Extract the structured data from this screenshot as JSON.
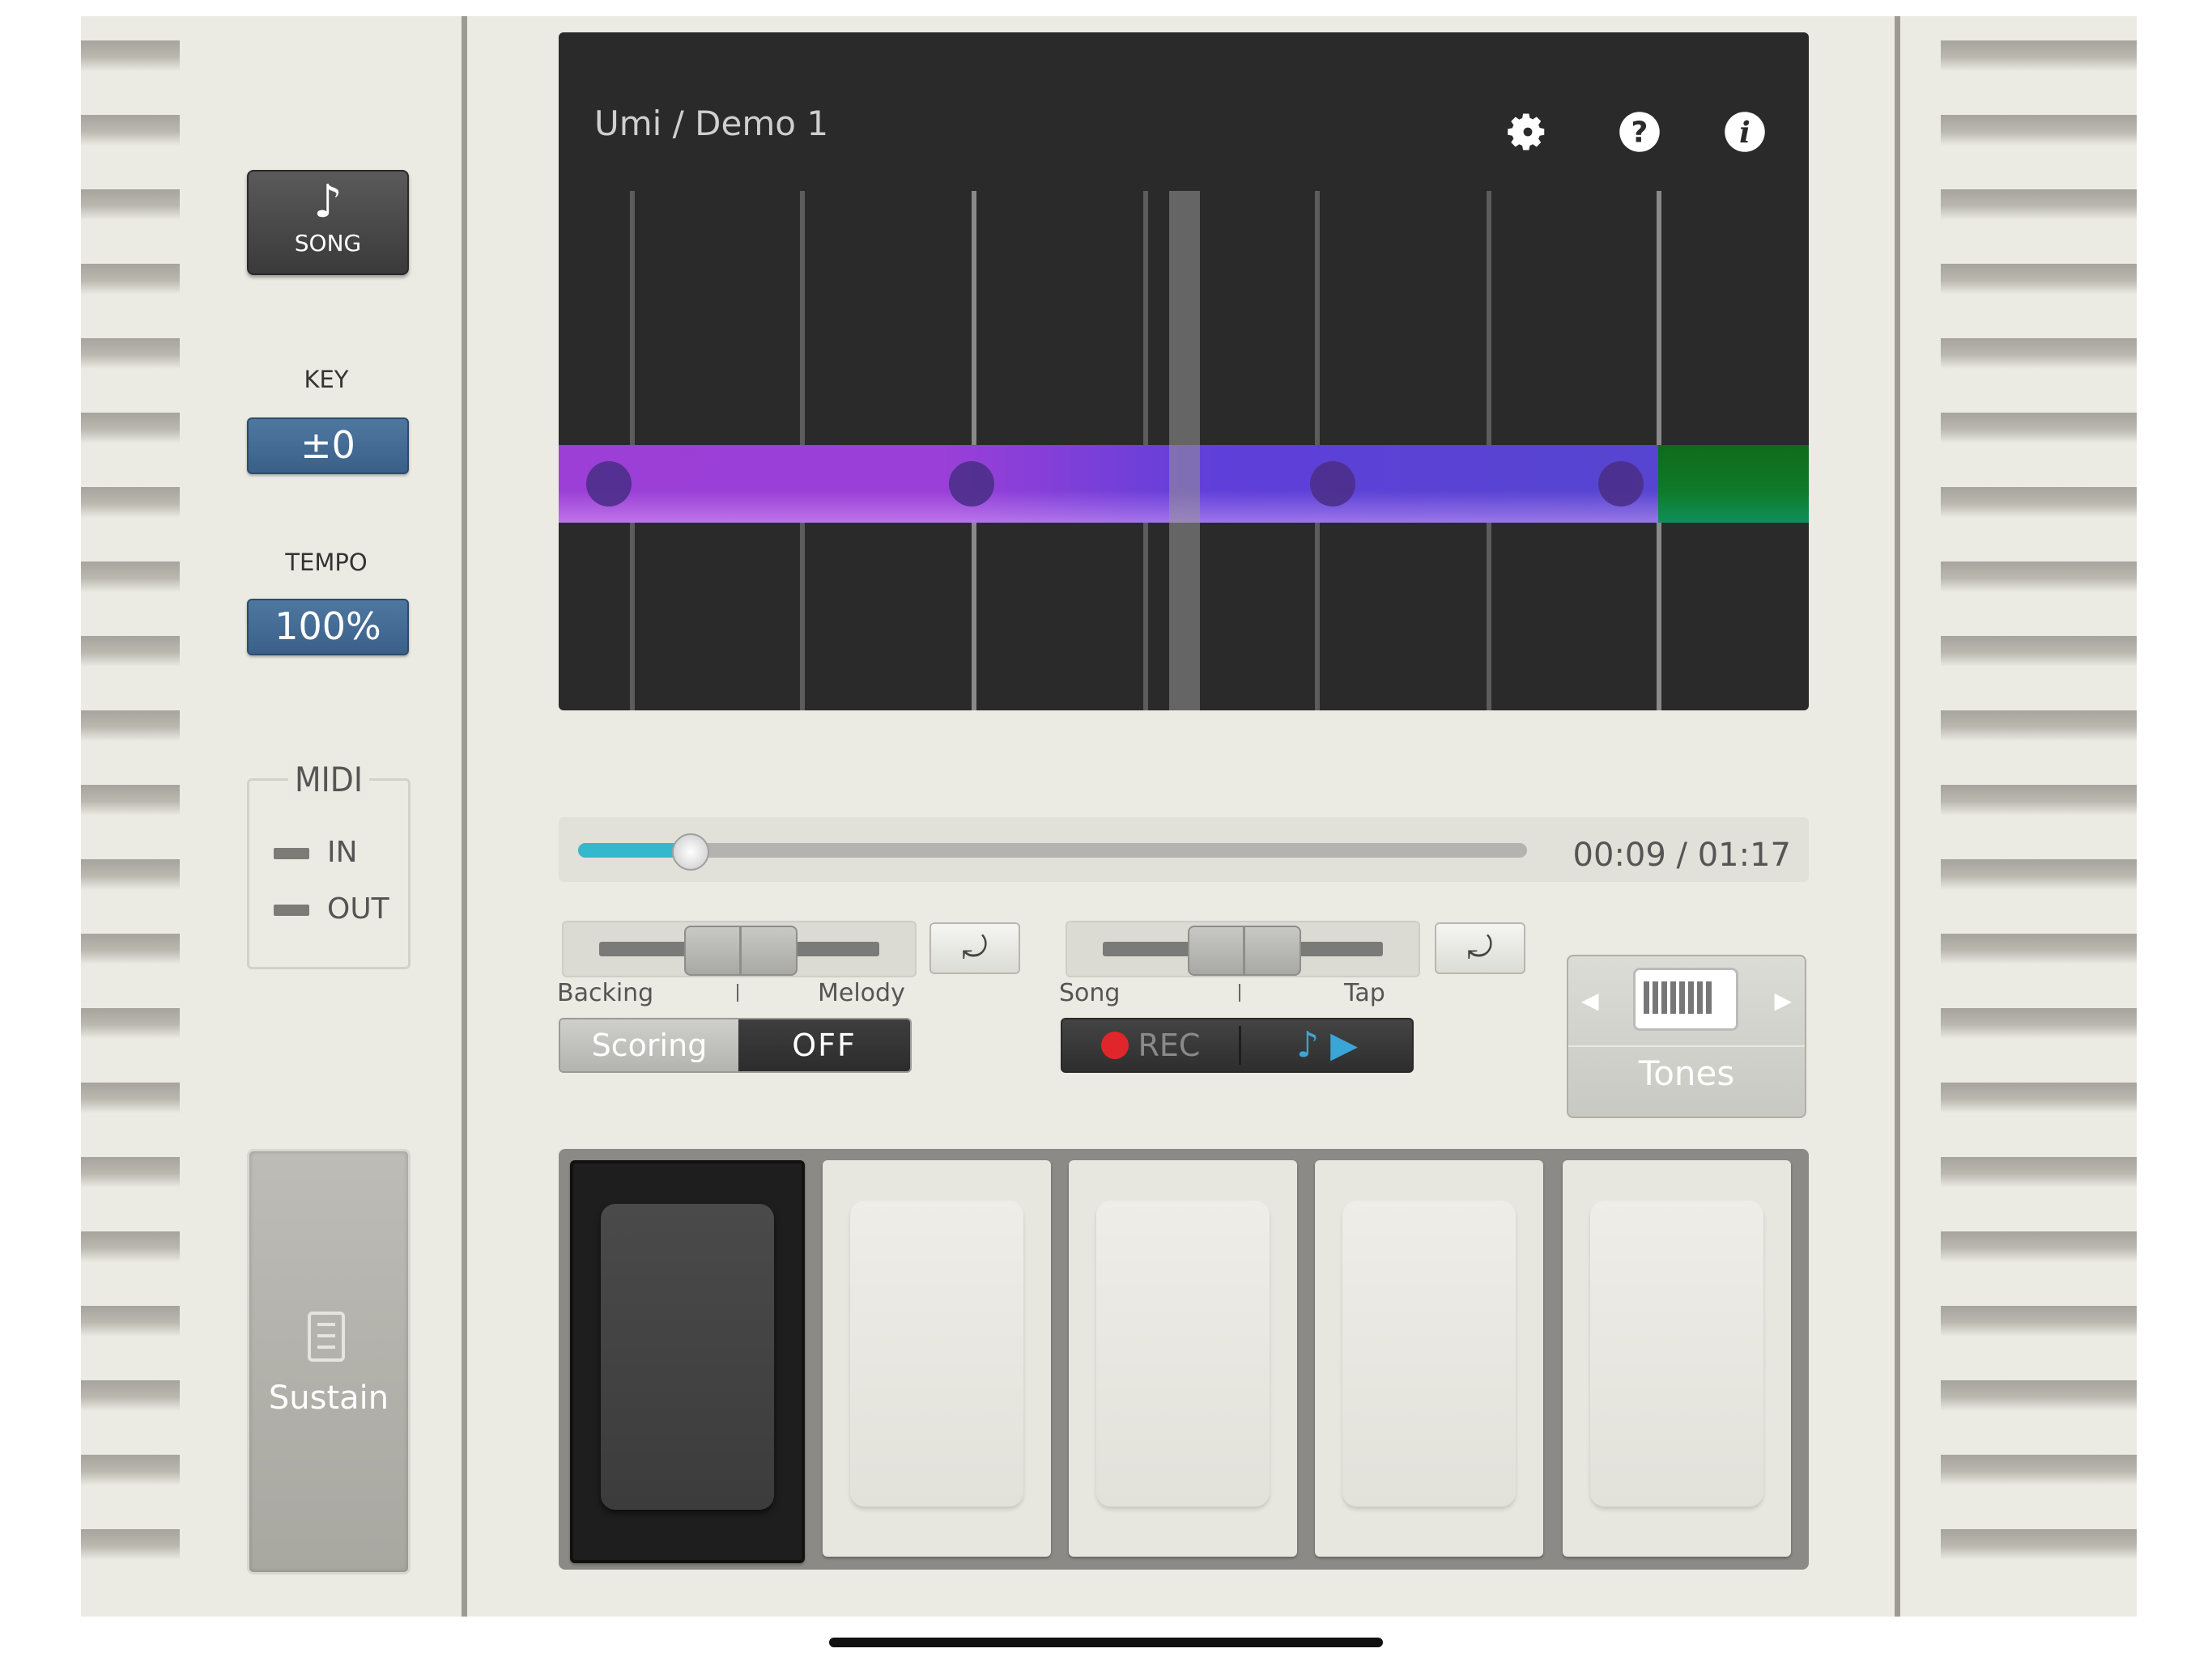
{
  "left_panel": {
    "song_button": {
      "icon": "eighth-note-icon",
      "note_glyph": "♪",
      "label": "SONG"
    },
    "key": {
      "label": "KEY",
      "value": "±0"
    },
    "tempo": {
      "label": "TEMPO",
      "value": "100%"
    },
    "midi": {
      "title": "MIDI",
      "in_label": "IN",
      "out_label": "OUT"
    },
    "sustain": {
      "icon": "pedal-icon",
      "label": "Sustain"
    }
  },
  "display": {
    "song_title": "Umi / Demo 1",
    "icons": [
      "gear-icon",
      "help-icon",
      "info-icon"
    ]
  },
  "progress": {
    "fraction": 0.1168,
    "time_text": "00:09 / 01:17"
  },
  "balance_backing_melody": {
    "left_label": "Backing",
    "right_label": "Melody",
    "position": 0.5
  },
  "balance_song_tap": {
    "left_label": "Song",
    "right_label": "Tap",
    "position": 0.5
  },
  "scoring": {
    "label": "Scoring",
    "state": "OFF"
  },
  "rec_play": {
    "rec_label": "REC",
    "play_glyph": "♪ ▶"
  },
  "tones": {
    "label": "Tones",
    "icon": "keyboard-icon"
  },
  "colors": {
    "accent_blue": "#3a6088",
    "progress_cyan": "#33b8cc",
    "melody_purple": "#9b3fd6",
    "melody_green": "#0f7a2a",
    "rec_red": "#e0262a",
    "play_blue": "#3aa6d8"
  },
  "pads": {
    "count": 5,
    "active_index": 0
  }
}
